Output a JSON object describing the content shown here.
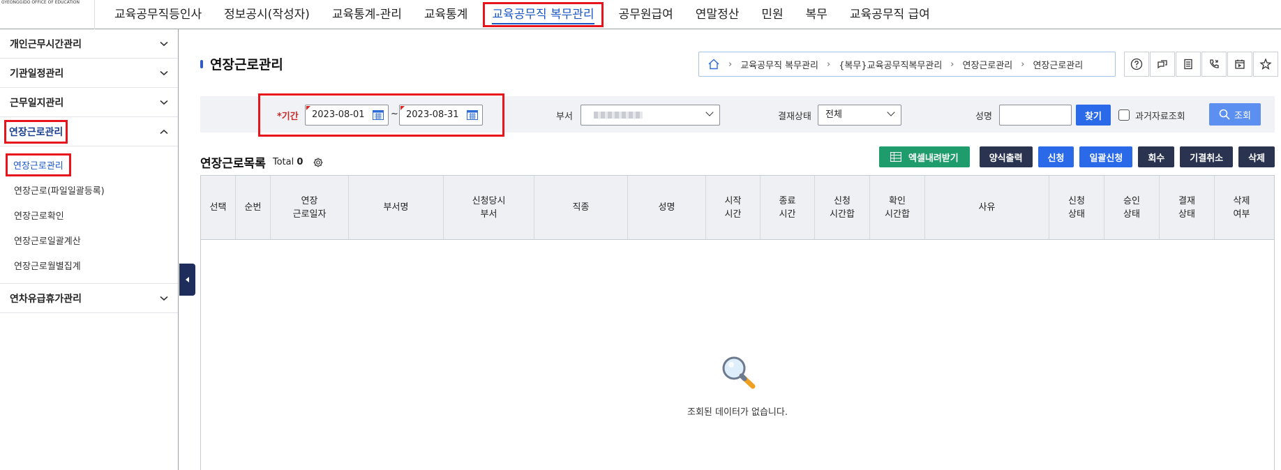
{
  "logo": {
    "text": "GYEONGGIDO OFFICE OF EDUCATION"
  },
  "nav": {
    "items": [
      {
        "label": "교육공무직등인사"
      },
      {
        "label": "정보공시(작성자)"
      },
      {
        "label": "교육통계-관리"
      },
      {
        "label": "교육통계"
      },
      {
        "label": "교육공무직 복무관리",
        "active": true
      },
      {
        "label": "공무원급여"
      },
      {
        "label": "연말정산"
      },
      {
        "label": "민원"
      },
      {
        "label": "복무"
      },
      {
        "label": "교육공무직 급여"
      }
    ]
  },
  "sidebar": {
    "groups": [
      {
        "label": "개인근무시간관리"
      },
      {
        "label": "기관일정관리"
      },
      {
        "label": "근무일지관리"
      },
      {
        "label": "연장근로관리",
        "open": true,
        "subitems": [
          {
            "label": "연장근로관리",
            "active": true
          },
          {
            "label": "연장근로(파일일괄등록)"
          },
          {
            "label": "연장근로확인"
          },
          {
            "label": "연장근로일괄계산"
          },
          {
            "label": "연장근로월별집계"
          }
        ]
      },
      {
        "label": "연차유급휴가관리"
      }
    ]
  },
  "page": {
    "title": "연장근로관리"
  },
  "breadcrumb": [
    "교육공무직 복무관리",
    "{복무}교육공무직복무관리",
    "연장근로관리",
    "연장근로관리"
  ],
  "tools": [
    "help-icon",
    "chat-icon",
    "document-icon",
    "phone-icon",
    "calendar-icon",
    "star-icon"
  ],
  "search": {
    "period_label": "*기간",
    "date_from": "2023-08-01",
    "tilde": "~",
    "date_to": "2023-08-31",
    "dept_label": "부서",
    "status_label": "결재상태",
    "status_value": "전체",
    "name_label": "성명",
    "name_value": "",
    "find_button": "찾기",
    "past_label": "과거자료조회",
    "query_button": "조회"
  },
  "list": {
    "title": "연장근로목록",
    "total_label": "Total",
    "total_count": "0"
  },
  "actions": {
    "excel": "엑셀내려받기",
    "print": "양식출력",
    "apply": "신청",
    "bulk_apply": "일괄신청",
    "withdraw": "회수",
    "cancel": "기결취소",
    "delete": "삭제"
  },
  "table": {
    "columns": [
      {
        "label": "선택"
      },
      {
        "label": "순번"
      },
      {
        "label": "연장\n근로일자"
      },
      {
        "label": "부서명"
      },
      {
        "label": "신청당시\n부서"
      },
      {
        "label": "직종"
      },
      {
        "label": "성명"
      },
      {
        "label": "시작\n시간"
      },
      {
        "label": "종료\n시간"
      },
      {
        "label": "신청\n시간합"
      },
      {
        "label": "확인\n시간합"
      },
      {
        "label": "사유"
      },
      {
        "label": "신청\n상태"
      },
      {
        "label": "승인\n상태"
      },
      {
        "label": "결재\n상태"
      },
      {
        "label": "삭제\n여부"
      }
    ],
    "empty_message": "조회된 데이터가 없습니다."
  }
}
